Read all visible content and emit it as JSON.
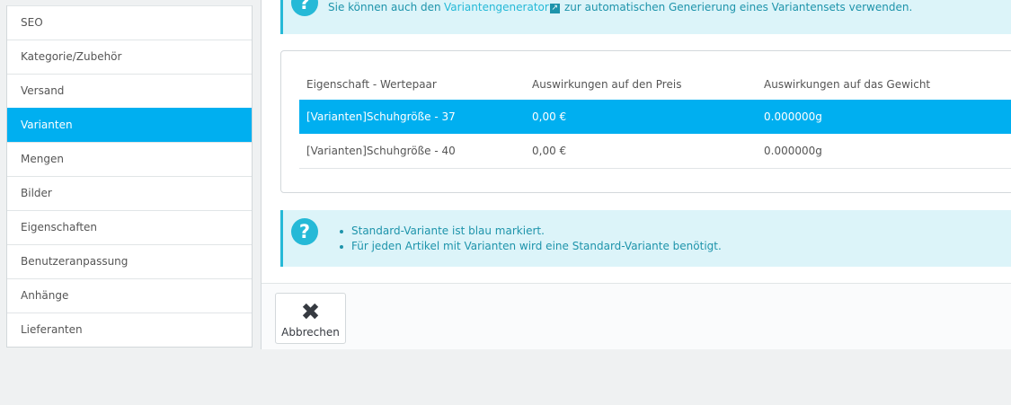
{
  "sidebar": {
    "items": [
      {
        "label": "SEO"
      },
      {
        "label": "Kategorie/Zubehör"
      },
      {
        "label": "Versand"
      },
      {
        "label": "Varianten"
      },
      {
        "label": "Mengen"
      },
      {
        "label": "Bilder"
      },
      {
        "label": "Eigenschaften"
      },
      {
        "label": "Benutzeranpassung"
      },
      {
        "label": "Anhänge"
      },
      {
        "label": "Lieferanten"
      }
    ],
    "active": "Varianten"
  },
  "info_top": {
    "text_before": "Sie können auch den",
    "link": "Variantengenerator",
    "text_after": "zur automatischen Generierung eines Variantensets verwenden."
  },
  "table": {
    "headers": [
      "Eigenschaft - Wertepaar",
      "Auswirkungen auf den Preis",
      "Auswirkungen auf das Gewicht"
    ],
    "rows": [
      {
        "pair": "[Varianten]Schuhgröße - 37",
        "price": "0,00 €",
        "weight": "0.000000g",
        "default": true
      },
      {
        "pair": "[Varianten]Schuhgröße - 40",
        "price": "0,00 €",
        "weight": "0.000000g",
        "default": false
      }
    ]
  },
  "info_bottom": {
    "items": [
      "Standard-Variante ist blau markiert.",
      "Für jeden Artikel mit Varianten wird eine Standard-Variante benötigt."
    ]
  },
  "footer": {
    "cancel_label": "Abbrechen"
  },
  "colors": {
    "accent": "#00aff0",
    "info_bg": "#dcf4f9",
    "info_text": "#1e94ab"
  }
}
